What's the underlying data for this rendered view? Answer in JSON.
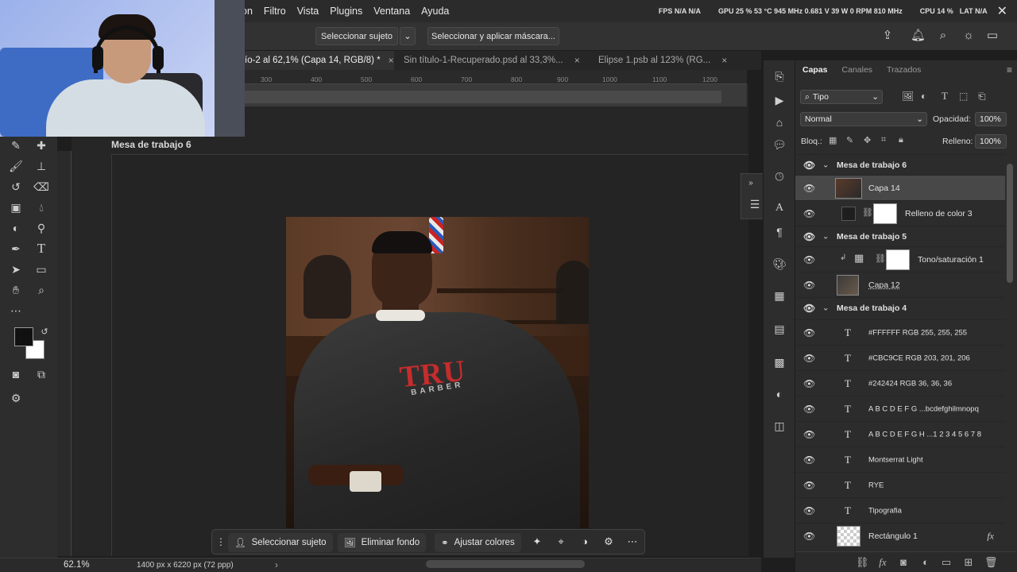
{
  "menu": {
    "items": [
      "on",
      "Filtro",
      "Vista",
      "Plugins",
      "Ventana",
      "Ayuda"
    ]
  },
  "status_top": {
    "fps": "FPS N/A N/A",
    "gpu": "GPU 25 % 53 °C 945 MHz 0.681 V 39 W 0 RPM 810 MHz",
    "cpu": "CPU 14 %",
    "lat": "LAT N/A"
  },
  "options_bar": {
    "select_subject": "Seleccionar sujeto",
    "select_mask": "Seleccionar y aplicar máscara..."
  },
  "tabs": [
    {
      "label": "ío-2 al 62,1% (Capa 14, RGB/8) *",
      "active": true
    },
    {
      "label": "Sin título-1-Recuperado.psd al 33,3%...",
      "active": false
    },
    {
      "label": "Elipse 1.psb al 123% (RG...",
      "active": false
    }
  ],
  "ruler_ticks": [
    "300",
    "400",
    "500",
    "600",
    "700",
    "800",
    "900",
    "1000",
    "1100",
    "1200"
  ],
  "canvas": {
    "artboard_label": "Mesa de trabajo 6",
    "photo_logo": "TRU",
    "photo_logo_sub": "BARBER"
  },
  "context_bar": {
    "select_subject": "Seleccionar sujeto",
    "remove_bg": "Eliminar fondo",
    "adjust_colors": "Ajustar colores"
  },
  "status_bottom": {
    "zoom": "62.1%",
    "doc_size": "1400 px x 6220 px (72 ppp)"
  },
  "layers_panel": {
    "tabs": [
      "Capas",
      "Canales",
      "Trazados"
    ],
    "filter": "Tipo",
    "blend_mode": "Normal",
    "opacity_label": "Opacidad:",
    "opacity_value": "100%",
    "lock_label": "Bloq.:",
    "fill_label": "Relleno:",
    "fill_value": "100%",
    "layers": [
      {
        "name": "Mesa de trabajo 6",
        "kind": "group"
      },
      {
        "name": "Capa 14",
        "kind": "image",
        "selected": true
      },
      {
        "name": "Relleno de color 3",
        "kind": "fill"
      },
      {
        "name": "Mesa de trabajo 5",
        "kind": "group"
      },
      {
        "name": "Tono/saturación 1",
        "kind": "adjustment"
      },
      {
        "name": "Capa 12",
        "kind": "image"
      },
      {
        "name": "Mesa de trabajo 4",
        "kind": "group"
      },
      {
        "name": "#FFFFFF RGB 255, 255, 255",
        "kind": "text"
      },
      {
        "name": "#CBC9CE RGB 203, 201, 206",
        "kind": "text"
      },
      {
        "name": "#242424 RGB 36, 36, 36",
        "kind": "text"
      },
      {
        "name": "A B C D E F G ...bcdefghilmnopq",
        "kind": "text"
      },
      {
        "name": "A B C D E F G H ...1 2 3 4 5 6 7 8",
        "kind": "text"
      },
      {
        "name": "Montserrat Light",
        "kind": "text"
      },
      {
        "name": "RYE",
        "kind": "text"
      },
      {
        "name": "Tipografia",
        "kind": "text"
      },
      {
        "name": "Rectángulo 1",
        "kind": "shape"
      }
    ]
  },
  "colors": {
    "menubar_bg": "#2b2b2b",
    "panel_bg": "#2c2c2c",
    "canvas_bg": "#262626",
    "selected_layer": "#484848",
    "foreground": "#111111",
    "background": "#ffffff"
  }
}
